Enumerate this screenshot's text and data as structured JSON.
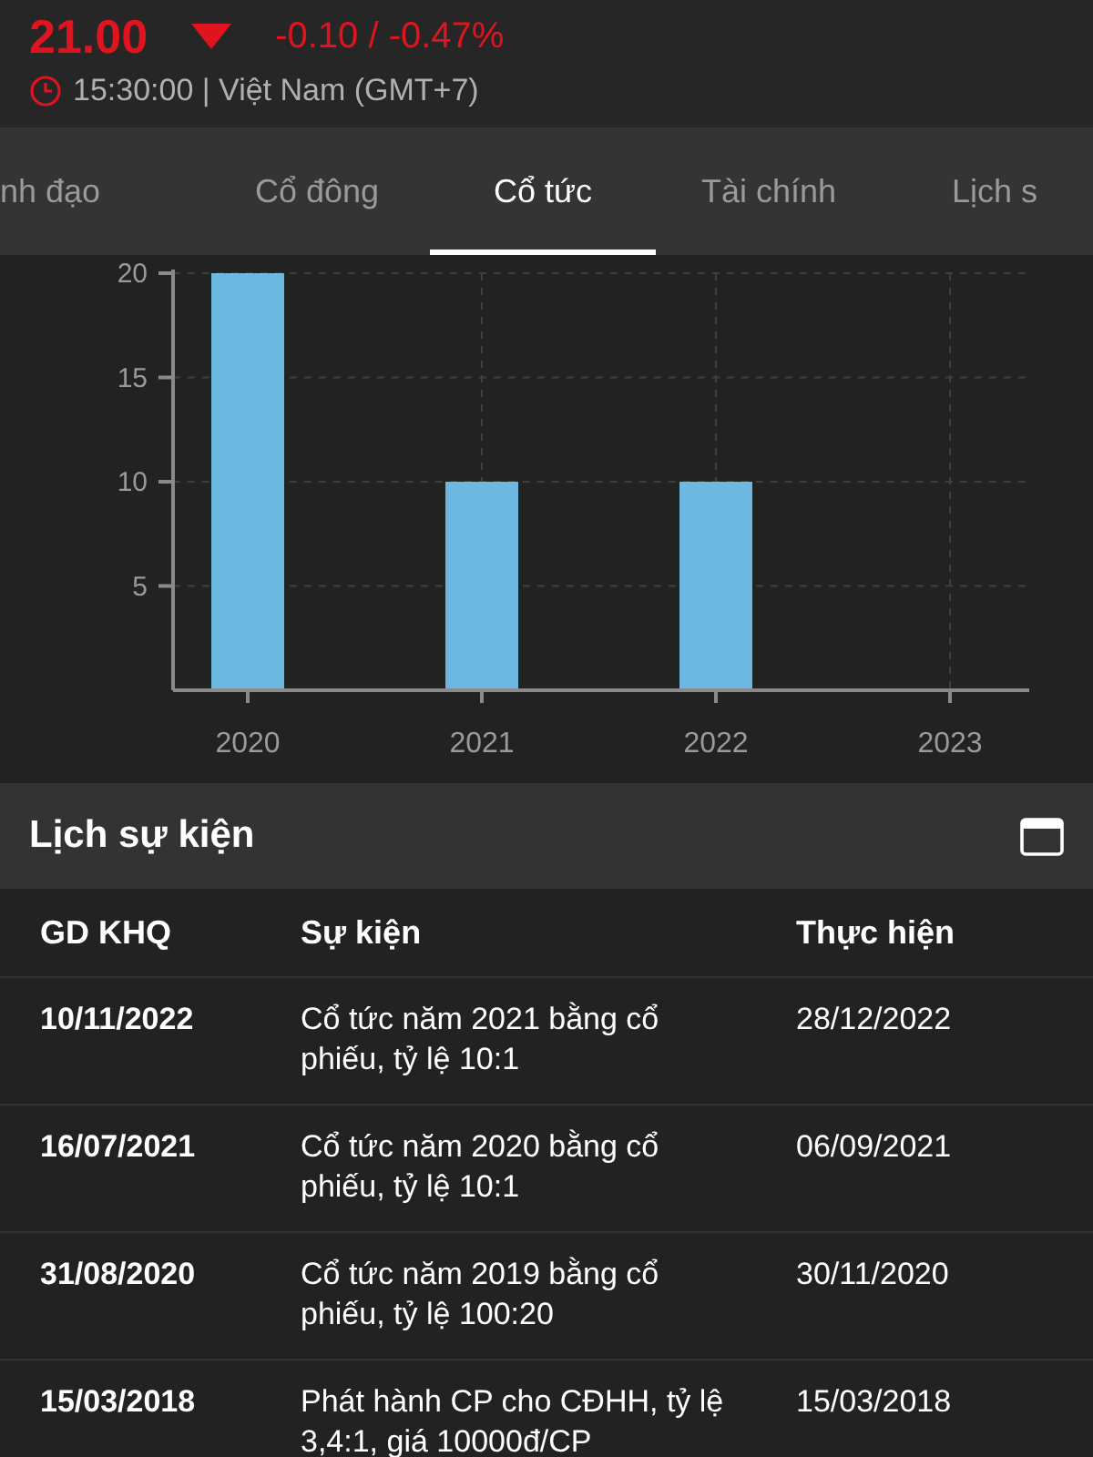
{
  "quote": {
    "price": "21.00",
    "change": "-0.10 / -0.47%",
    "time": "15:30:00 | Việt Nam (GMT+7)"
  },
  "tabs": [
    {
      "label": "nh đạo",
      "selected": false
    },
    {
      "label": "Cổ đông",
      "selected": false
    },
    {
      "label": "Cổ tức",
      "selected": true
    },
    {
      "label": "Tài chính",
      "selected": false
    },
    {
      "label": "Lịch s",
      "selected": false
    }
  ],
  "chart": {
    "chart_data": {
      "type": "bar",
      "categories": [
        "2020",
        "2021",
        "2022",
        "2023"
      ],
      "series": [
        {
          "color": "#6bb8e0",
          "values": [
            20,
            10,
            10,
            null
          ]
        }
      ],
      "grid": true,
      "ylim": [
        0,
        20
      ],
      "yticks": [
        5,
        10,
        15,
        20
      ]
    }
  },
  "events": {
    "title": "Lịch sự kiện",
    "columns": [
      "GD KHQ",
      "Sự kiện",
      "Thực hiện"
    ],
    "rows": [
      [
        "10/11/2022",
        "Cổ tức năm 2021 bằng cổ phiếu, tỷ lệ 10:1",
        "28/12/2022"
      ],
      [
        "16/07/2021",
        "Cổ tức năm 2020 bằng cổ phiếu, tỷ lệ 10:1",
        "06/09/2021"
      ],
      [
        "31/08/2020",
        "Cổ tức năm 2019 bằng cổ phiếu, tỷ lệ 100:20",
        "30/11/2020"
      ],
      [
        "15/03/2018",
        "Phát hành CP cho CĐHH, tỷ lệ 3,4:1, giá 10000đ/CP",
        "15/03/2018"
      ]
    ]
  }
}
